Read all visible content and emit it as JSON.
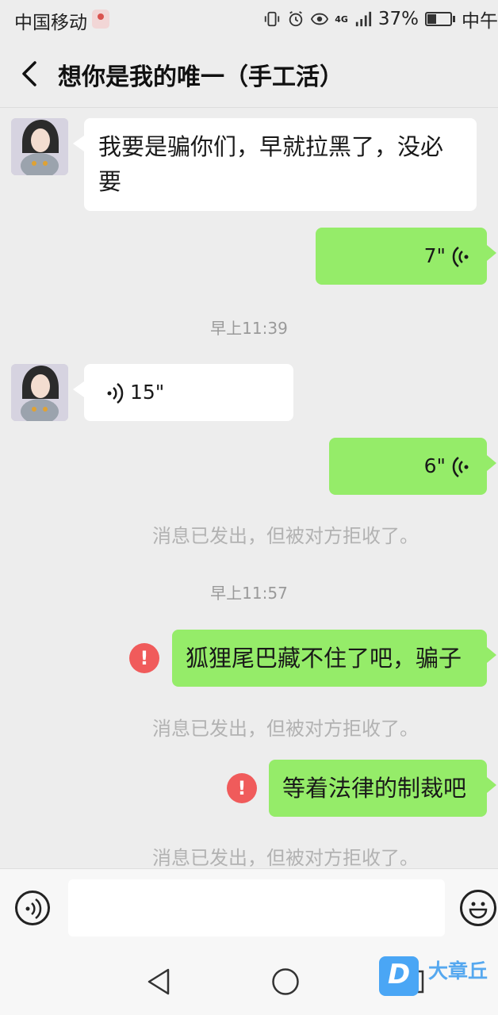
{
  "status_bar": {
    "carrier": "中国移动",
    "network": "4G",
    "battery": "37%",
    "time_partial": "中午"
  },
  "header": {
    "title": "想你是我的唯一（手工活）"
  },
  "messages": [
    {
      "type": "text",
      "side": "in",
      "text": "我要是骗你们，早就拉黑了，没必要"
    },
    {
      "type": "voice",
      "side": "out",
      "duration": "7\""
    },
    {
      "type": "time",
      "text": "早上11:39"
    },
    {
      "type": "voice",
      "side": "in",
      "duration": "15\""
    },
    {
      "type": "voice",
      "side": "out",
      "duration": "6\""
    },
    {
      "type": "system",
      "text": "消息已发出，但被对方拒收了。"
    },
    {
      "type": "time",
      "text": "早上11:57"
    },
    {
      "type": "text",
      "side": "out",
      "text": "狐狸尾巴藏不住了吧，骗子",
      "failed": true,
      "error_mark": "!"
    },
    {
      "type": "system",
      "text": "消息已发出，但被对方拒收了。"
    },
    {
      "type": "text",
      "side": "out",
      "text": "等着法律的制裁吧",
      "failed": true,
      "error_mark": "!"
    },
    {
      "type": "system",
      "text": "消息已发出，但被对方拒收了。"
    }
  ],
  "input_bar": {
    "value": ""
  },
  "watermark": {
    "text": "大章丘",
    "logo_letter": "D"
  },
  "colors": {
    "background": "#ededed",
    "outgoing_bubble": "#95ec69",
    "incoming_bubble": "#ffffff",
    "error": "#f05b5b"
  }
}
